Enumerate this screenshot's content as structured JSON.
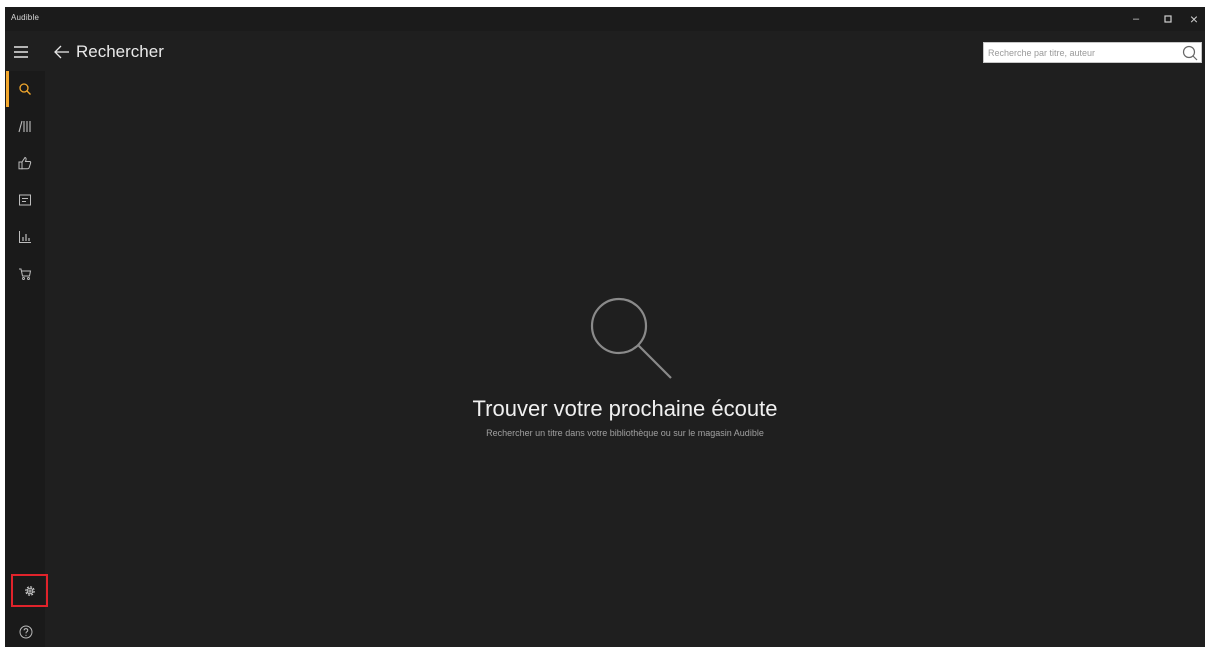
{
  "window": {
    "title": "Audible",
    "buttons": {
      "minimize": "–",
      "close": "×"
    }
  },
  "header": {
    "page_title": "Rechercher",
    "search_placeholder": "Recherche par titre, auteur"
  },
  "sidebar": {
    "items": [
      {
        "id": "search",
        "icon": "search-icon",
        "active": true
      },
      {
        "id": "library",
        "icon": "library-icon",
        "active": false
      },
      {
        "id": "recommendations",
        "icon": "thumbs-up-icon",
        "active": false
      },
      {
        "id": "notes",
        "icon": "notes-icon",
        "active": false
      },
      {
        "id": "stats",
        "icon": "stats-icon",
        "active": false
      },
      {
        "id": "store",
        "icon": "cart-icon",
        "active": false
      }
    ],
    "bottom": [
      {
        "id": "settings",
        "icon": "gear-icon",
        "highlighted": true
      },
      {
        "id": "help",
        "icon": "help-icon"
      }
    ]
  },
  "empty_state": {
    "icon": "search-icon",
    "title": "Trouver votre prochaine écoute",
    "subtitle": "Rechercher un titre dans votre bibliothèque ou sur le magasin Audible"
  },
  "colors": {
    "background": "#1f1f1f",
    "sidebar": "#1a1a1a",
    "accent": "#f3a82d",
    "highlight_box": "#e0232b"
  }
}
